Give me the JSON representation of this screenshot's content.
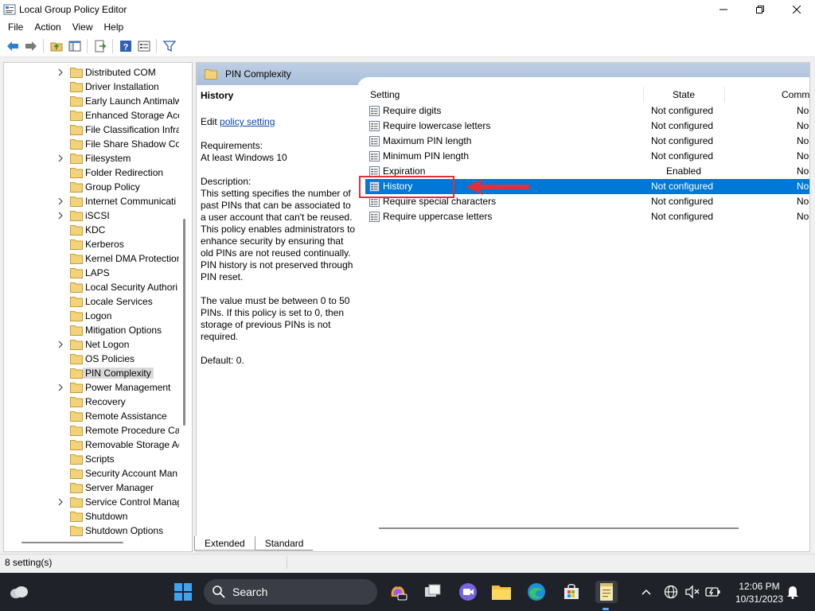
{
  "window": {
    "title": "Local Group Policy Editor"
  },
  "menu": [
    "File",
    "Action",
    "View",
    "Help"
  ],
  "tree": {
    "items": [
      {
        "label": "Distributed COM",
        "expandable": true
      },
      {
        "label": "Driver Installation",
        "expandable": false
      },
      {
        "label": "Early Launch Antimalw",
        "expandable": false
      },
      {
        "label": "Enhanced Storage Acc",
        "expandable": false
      },
      {
        "label": "File Classification Infra",
        "expandable": false
      },
      {
        "label": "File Share Shadow Cop",
        "expandable": false
      },
      {
        "label": "Filesystem",
        "expandable": true
      },
      {
        "label": "Folder Redirection",
        "expandable": false
      },
      {
        "label": "Group Policy",
        "expandable": false
      },
      {
        "label": "Internet Communicati",
        "expandable": true
      },
      {
        "label": "iSCSI",
        "expandable": true
      },
      {
        "label": "KDC",
        "expandable": false
      },
      {
        "label": "Kerberos",
        "expandable": false
      },
      {
        "label": "Kernel DMA Protection",
        "expandable": false
      },
      {
        "label": "LAPS",
        "expandable": false
      },
      {
        "label": "Local Security Authori",
        "expandable": false
      },
      {
        "label": "Locale Services",
        "expandable": false
      },
      {
        "label": "Logon",
        "expandable": false
      },
      {
        "label": "Mitigation Options",
        "expandable": false
      },
      {
        "label": "Net Logon",
        "expandable": true
      },
      {
        "label": "OS Policies",
        "expandable": false
      },
      {
        "label": "PIN Complexity",
        "expandable": false,
        "selected": true
      },
      {
        "label": "Power Management",
        "expandable": true
      },
      {
        "label": "Recovery",
        "expandable": false
      },
      {
        "label": "Remote Assistance",
        "expandable": false
      },
      {
        "label": "Remote Procedure Ca",
        "expandable": false
      },
      {
        "label": "Removable Storage Ac",
        "expandable": false
      },
      {
        "label": "Scripts",
        "expandable": false
      },
      {
        "label": "Security Account Man",
        "expandable": false
      },
      {
        "label": "Server Manager",
        "expandable": false
      },
      {
        "label": "Service Control Manag",
        "expandable": true
      },
      {
        "label": "Shutdown",
        "expandable": false
      },
      {
        "label": "Shutdown Options",
        "expandable": false
      }
    ]
  },
  "right_header": {
    "title": "PIN Complexity"
  },
  "description": {
    "title": "History",
    "edit_prefix": "Edit",
    "edit_link": "policy setting",
    "requirements_label": "Requirements:",
    "requirements_value": "At least Windows 10",
    "description_label": "Description:",
    "description_text": "This setting specifies the number of past PINs that can be associated to a user account that can't be reused. This policy enables administrators to enhance security by ensuring that old PINs are not reused continually. PIN history is not preserved through PIN reset.",
    "range_text": "The value must be between 0 to 50 PINs. If this policy is set to 0, then storage of previous PINs is not required.",
    "default_text": "Default: 0."
  },
  "list": {
    "columns": {
      "setting": "Setting",
      "state": "State",
      "comment": "Comm"
    },
    "rows": [
      {
        "name": "Require digits",
        "state": "Not configured",
        "comment": "No"
      },
      {
        "name": "Require lowercase letters",
        "state": "Not configured",
        "comment": "No"
      },
      {
        "name": "Maximum PIN length",
        "state": "Not configured",
        "comment": "No"
      },
      {
        "name": "Minimum PIN length",
        "state": "Not configured",
        "comment": "No"
      },
      {
        "name": "Expiration",
        "state": "Enabled",
        "comment": "No"
      },
      {
        "name": "History",
        "state": "Not configured",
        "comment": "No",
        "selected": true
      },
      {
        "name": "Require special characters",
        "state": "Not configured",
        "comment": "No"
      },
      {
        "name": "Require uppercase letters",
        "state": "Not configured",
        "comment": "No"
      }
    ]
  },
  "tabs": [
    "Extended",
    "Standard"
  ],
  "status": {
    "text": "8 setting(s)"
  },
  "taskbar": {
    "search_label": "Search",
    "time": "12:06 PM",
    "date": "10/31/2023"
  },
  "colors": {
    "selection": "#0078d7",
    "highlight_box": "#e0303c",
    "header_gradient": "#a9bfdb"
  }
}
